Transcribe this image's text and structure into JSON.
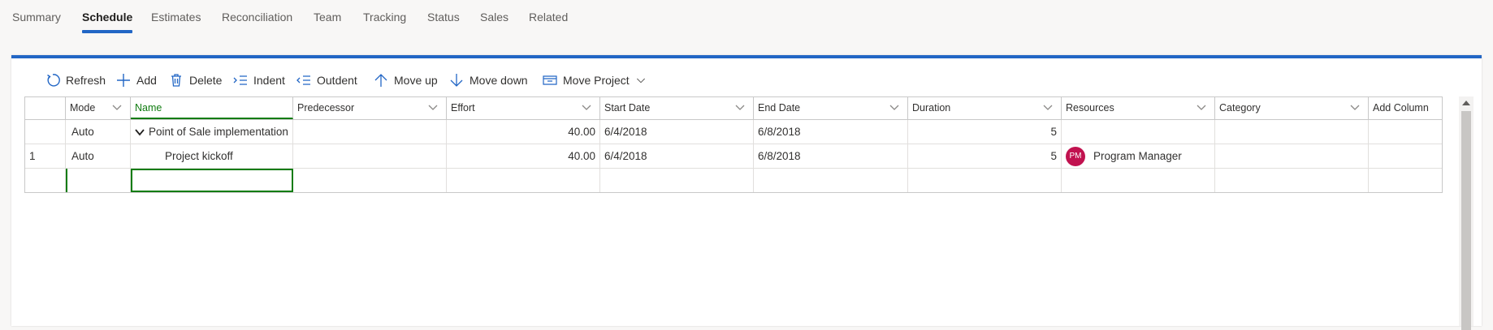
{
  "tabs": [
    {
      "label": "Summary"
    },
    {
      "label": "Schedule"
    },
    {
      "label": "Estimates"
    },
    {
      "label": "Reconciliation"
    },
    {
      "label": "Team"
    },
    {
      "label": "Tracking"
    },
    {
      "label": "Status"
    },
    {
      "label": "Sales"
    },
    {
      "label": "Related"
    }
  ],
  "active_tab": "Schedule",
  "toolbar": {
    "refresh": "Refresh",
    "add": "Add",
    "delete": "Delete",
    "indent": "Indent",
    "outdent": "Outdent",
    "move_up": "Move up",
    "move_down": "Move down",
    "move_project": "Move Project"
  },
  "grid": {
    "columns": {
      "mode": "Mode",
      "name": "Name",
      "predecessor": "Predecessor",
      "effort": "Effort",
      "start_date": "Start Date",
      "end_date": "End Date",
      "duration": "Duration",
      "resources": "Resources",
      "category": "Category",
      "add_column": "Add Column"
    },
    "rows": [
      {
        "index": "",
        "mode": "Auto",
        "name": "Point of Sale implementation",
        "predecessor": "",
        "effort": "40.00",
        "start_date": "6/4/2018",
        "end_date": "6/8/2018",
        "duration": "5",
        "resource_initials": "",
        "resource_name": "",
        "category": ""
      },
      {
        "index": "1",
        "mode": "Auto",
        "name": "Project kickoff",
        "predecessor": "",
        "effort": "40.00",
        "start_date": "6/4/2018",
        "end_date": "6/8/2018",
        "duration": "5",
        "resource_initials": "PM",
        "resource_name": "Program Manager",
        "category": ""
      }
    ]
  },
  "colors": {
    "accent": "#2266c5",
    "selection": "#107c10",
    "avatar": "#c1124f"
  }
}
